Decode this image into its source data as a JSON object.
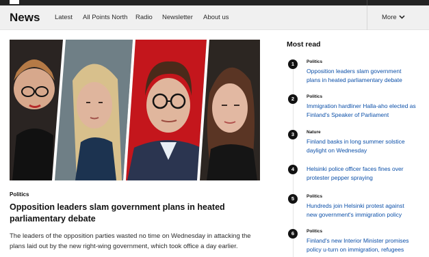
{
  "nav": {
    "brand": "News",
    "links": [
      "Latest",
      "All Points North",
      "Radio",
      "Newsletter",
      "About us"
    ],
    "more": "More"
  },
  "article": {
    "category": "Politics",
    "headline": "Opposition leaders slam government plans in heated parliamentary debate",
    "lead": "The leaders of the opposition parties wasted no time on Wednesday in attacking the plans laid out by the new right-wing government, which took office a day earlier."
  },
  "most_read": {
    "title": "Most read",
    "items": [
      {
        "num": "1",
        "category": "Politics",
        "text": "Opposition leaders slam government plans in heated parliamentary debate"
      },
      {
        "num": "2",
        "category": "Politics",
        "text": "Immigration hardliner Halla-aho elected as Finland's Speaker of Parliament"
      },
      {
        "num": "3",
        "category": "Nature",
        "text": "Finland basks in long summer solstice daylight on Wednesday"
      },
      {
        "num": "4",
        "category": "",
        "text": "Helsinki police officer faces fines over protester pepper spraying"
      },
      {
        "num": "5",
        "category": "Politics",
        "text": "Hundreds join Helsinki protest against new government's immigration policy"
      },
      {
        "num": "6",
        "category": "Politics",
        "text": "Finland's new Interior Minister promises policy u-turn on immigration, refugees"
      }
    ]
  },
  "colors": {
    "link": "#0b4fa8",
    "panel_red": "#c4161c"
  }
}
